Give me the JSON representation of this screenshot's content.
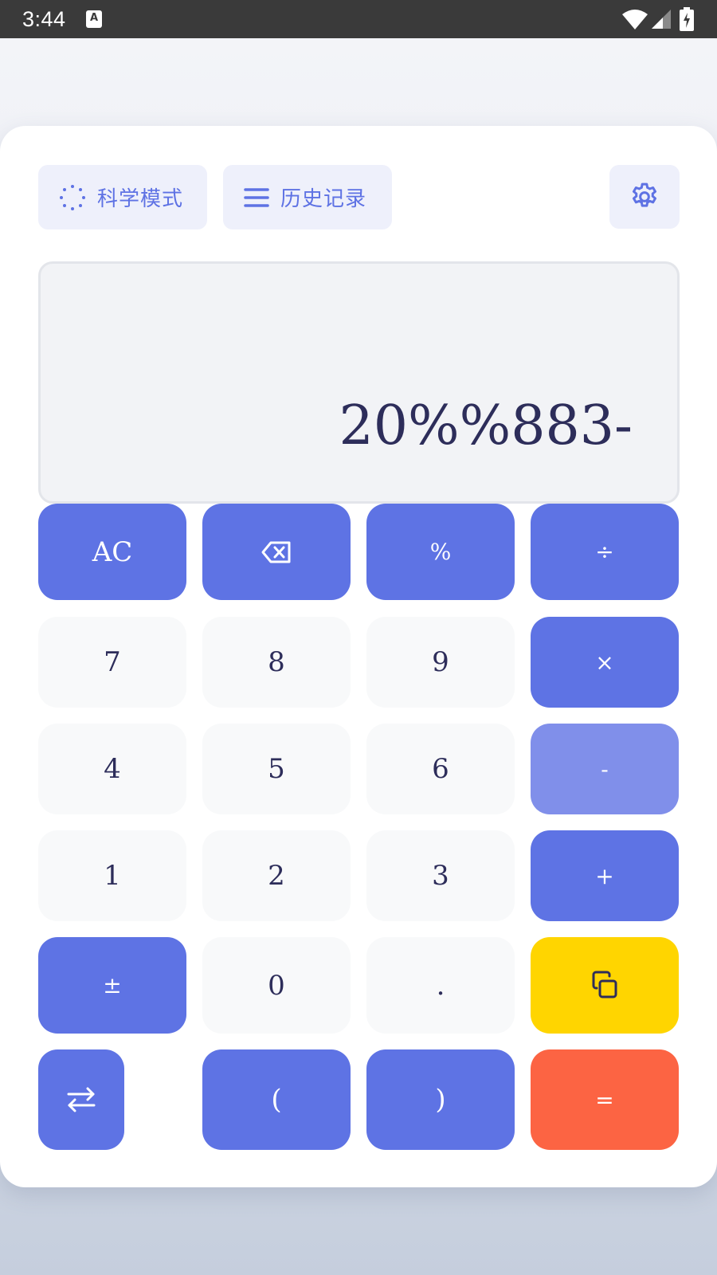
{
  "status_bar": {
    "time": "3:44",
    "notification_icon_letter": "A",
    "icons": [
      "wifi-icon",
      "signal-icon",
      "battery-charging-icon"
    ]
  },
  "toolbar": {
    "scientific_mode": {
      "label": "科学模式",
      "icon": "dotted-circle-icon"
    },
    "history": {
      "label": "历史记录",
      "icon": "menu-lines-icon"
    },
    "settings": {
      "icon": "gear-icon"
    }
  },
  "display": {
    "expression": "20%%883-"
  },
  "keypad": {
    "row1": [
      "AC",
      "backspace",
      "%",
      "÷"
    ],
    "row2": [
      "7",
      "8",
      "9",
      "×"
    ],
    "row3": [
      "4",
      "5",
      "6",
      "-"
    ],
    "row4": [
      "1",
      "2",
      "3",
      "+"
    ],
    "row5": [
      "±",
      "0",
      ".",
      "copy"
    ],
    "row6": [
      "swap",
      "(",
      ")",
      "="
    ]
  },
  "colors": {
    "accent": "#5e73e4",
    "accent_light": "#808fea",
    "copy_key": "#ffd500",
    "equals_key": "#fc6443",
    "number_key": "#f8f9fa",
    "text_dark": "#2d2d5a"
  }
}
